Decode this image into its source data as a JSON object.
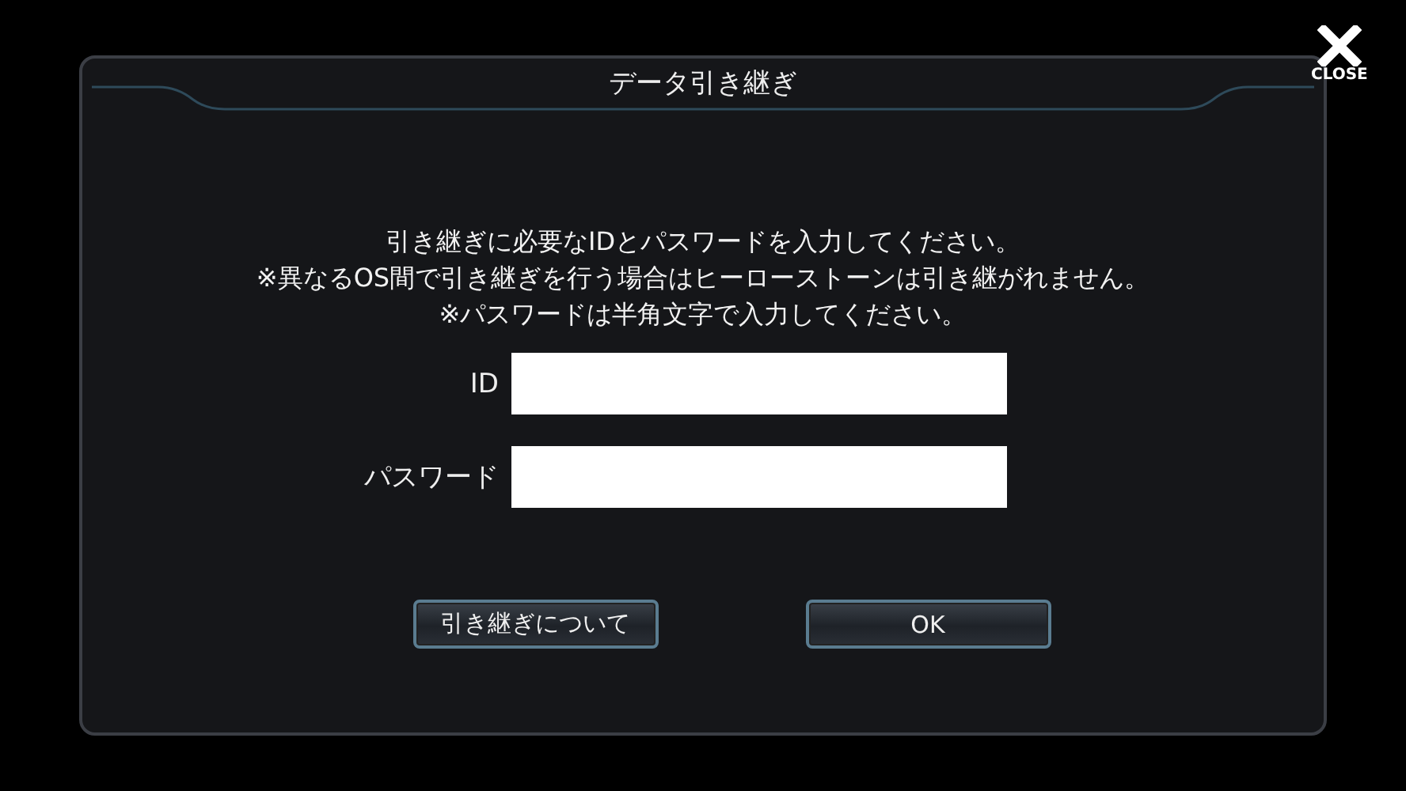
{
  "close": {
    "label": "CLOSE"
  },
  "dialog": {
    "title": "データ引き継ぎ"
  },
  "message_lines": [
    "引き継ぎに必要なIDとパスワードを入力してください。",
    "※異なるOS間で引き継ぎを行う場合はヒーローストーンは引き継がれません。",
    "※パスワードは半角文字で入力してください。"
  ],
  "fields": [
    {
      "label": "ID"
    },
    {
      "label": "パスワード"
    }
  ],
  "buttons": [
    "引き継ぎについて",
    "OK"
  ]
}
